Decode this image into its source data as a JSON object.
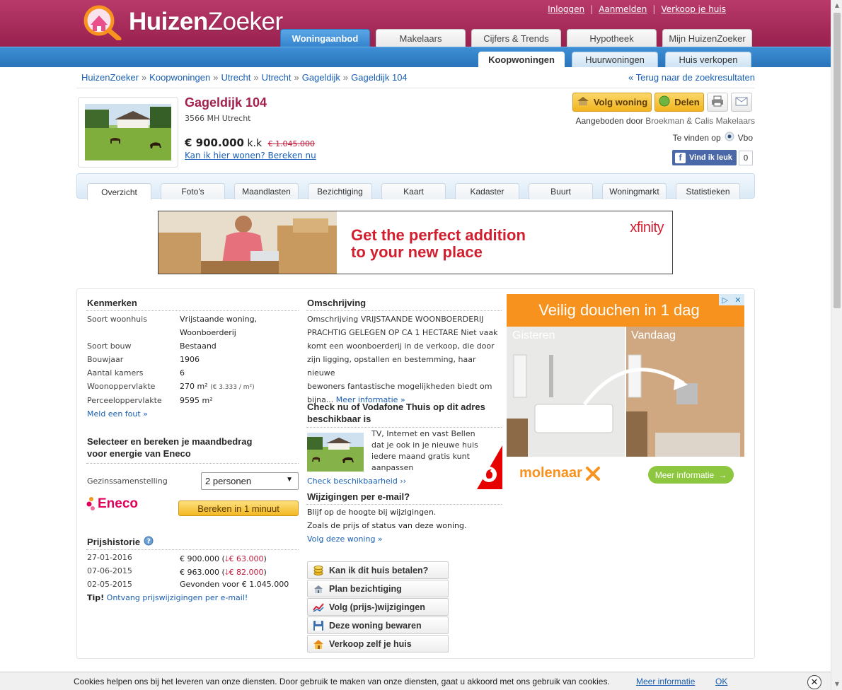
{
  "header": {
    "logo_text_bold": "Huizen",
    "logo_text_rest": "Zoeker",
    "top_links": [
      "Inloggen",
      "Aanmelden",
      "Verkoop je huis"
    ],
    "main_tabs": [
      "Woningaanbod",
      "Makelaars",
      "Cijfers & Trends",
      "Hypotheek",
      "Mijn HuizenZoeker"
    ],
    "active_main_tab": "Woningaanbod",
    "sub_tabs": [
      "Koopwoningen",
      "Huurwoningen",
      "Huis verkopen"
    ],
    "active_sub_tab": "Koopwoningen"
  },
  "breadcrumb": [
    "HuizenZoeker",
    "Koopwoningen",
    "Utrecht",
    "Utrecht",
    "Gageldijk",
    "Gageldijk 104"
  ],
  "breadcrumb_separator": "»",
  "back_link": "« Terug naar de zoekresultaten",
  "property": {
    "title": "Gageldijk 104",
    "zip_city": "3566 MH Utrecht",
    "price": "€ 900.000",
    "price_suffix": "k.k",
    "old_price": "€ 1.045.000",
    "calc_link": "Kan ik hier wonen? Bereken nu"
  },
  "actions": {
    "follow": "Volg woning",
    "share": "Delen",
    "offered_by_label": "Aangeboden door",
    "agent": "Broekman & Calis Makelaars",
    "found_on_label": "Te vinden op",
    "found_on_source": "Vbo",
    "fb_like": "Vind ik leuk",
    "fb_count": "0"
  },
  "detail_tabs": [
    "Overzicht",
    "Foto's",
    "Maandlasten",
    "Bezichtiging",
    "Kaart",
    "Kadaster",
    "Buurt",
    "Woningmarkt",
    "Statistieken"
  ],
  "active_detail_tab": "Overzicht",
  "banner_ad": {
    "headline_line1": "Get the perfect addition",
    "headline_line2": "to your new place",
    "brand": "xfinity"
  },
  "kenmerken": {
    "title": "Kenmerken",
    "rows": [
      {
        "label": "Soort woonhuis",
        "value": "Vrijstaande woning,"
      },
      {
        "label": "",
        "value": "Woonboerderij"
      },
      {
        "label": "Soort bouw",
        "value": "Bestaand"
      },
      {
        "label": "Bouwjaar",
        "value": "1906"
      },
      {
        "label": "Aantal kamers",
        "value": "6"
      },
      {
        "label": "Woonoppervlakte",
        "value": "270 m²",
        "extra": "(€ 3.333 / m²)"
      },
      {
        "label": "Perceeloppervlakte",
        "value": "9595 m²"
      }
    ],
    "report_link": "Meld een fout »"
  },
  "energy": {
    "title_line1": "Selecteer en bereken je maandbedrag",
    "title_line2": "voor energie van Eneco",
    "select_label": "Gezinssamenstelling",
    "select_value": "2 personen",
    "button": "Bereken in 1 minuut",
    "brand": "Eneco"
  },
  "price_history": {
    "title": "Prijshistorie",
    "rows": [
      {
        "date": "27-01-2016",
        "price": "€ 900.000",
        "change": "€ 63.000"
      },
      {
        "date": "07-06-2015",
        "price": "€ 963.000",
        "change": "€ 82.000"
      },
      {
        "date": "02-05-2015",
        "price": "Gevonden voor € 1.045.000",
        "change": ""
      }
    ],
    "tip_label": "Tip!",
    "tip_link": "Ontvang prijswijzigingen per e-mail!"
  },
  "description": {
    "title": "Omschrijving",
    "lines": [
      "Omschrijving VRIJSTAANDE WOONBOERDERIJ",
      "PRACHTIG GELEGEN OP CA 1 HECTARE Niet vaak",
      "komt een woonboerderij in de verkoop, die door",
      "zijn ligging, opstallen en bestemming, haar nieuwe",
      "bewoners fantastische mogelijkheden biedt om"
    ],
    "last_line": "bijna...",
    "more_link": "Meer informatie »"
  },
  "vodafone": {
    "title_line1": "Check nu of Vodafone Thuis op dit adres",
    "title_line2": "beschikbaar is",
    "text_lines": [
      "TV, Internet en vast Bellen",
      "dat je ook in je nieuwe huis",
      "iedere maand gratis kunt",
      "aanpassen"
    ],
    "link": "Check beschikbaarheid ››"
  },
  "email_updates": {
    "title": "Wijzigingen per e-mail?",
    "line1": "Blijf op de hoogte bij wijzigingen.",
    "line2": "Zoals de prijs of status van deze woning.",
    "link": "Volg deze woning »"
  },
  "side_buttons": [
    {
      "label": "Kan ik dit huis betalen?",
      "icon": "coins-icon"
    },
    {
      "label": "Plan bezichtiging",
      "icon": "calendar-house-icon"
    },
    {
      "label": "Volg (prijs-)wijzigingen",
      "icon": "chart-icon"
    },
    {
      "label": "Deze woning bewaren",
      "icon": "save-icon"
    },
    {
      "label": "Verkoop zelf je huis",
      "icon": "house-icon"
    }
  ],
  "side_ad": {
    "headline": "Veilig douchen in 1 dag",
    "label_before": "Gisteren",
    "label_after": "Vandaag",
    "brand": "molenaar",
    "cta": "Meer informatie"
  },
  "cookie_bar": {
    "text": "Cookies helpen ons bij het leveren van onze diensten. Door gebruik te maken van onze diensten, gaat u akkoord met ons gebruik van cookies.",
    "more_link": "Meer informatie",
    "ok": "OK"
  },
  "colors": {
    "brand_magenta": "#9d2452",
    "nav_blue": "#2a74b9",
    "link_blue": "#1a5fb4",
    "title_red": "#a3204e",
    "button_yellow": "#f1b520"
  }
}
